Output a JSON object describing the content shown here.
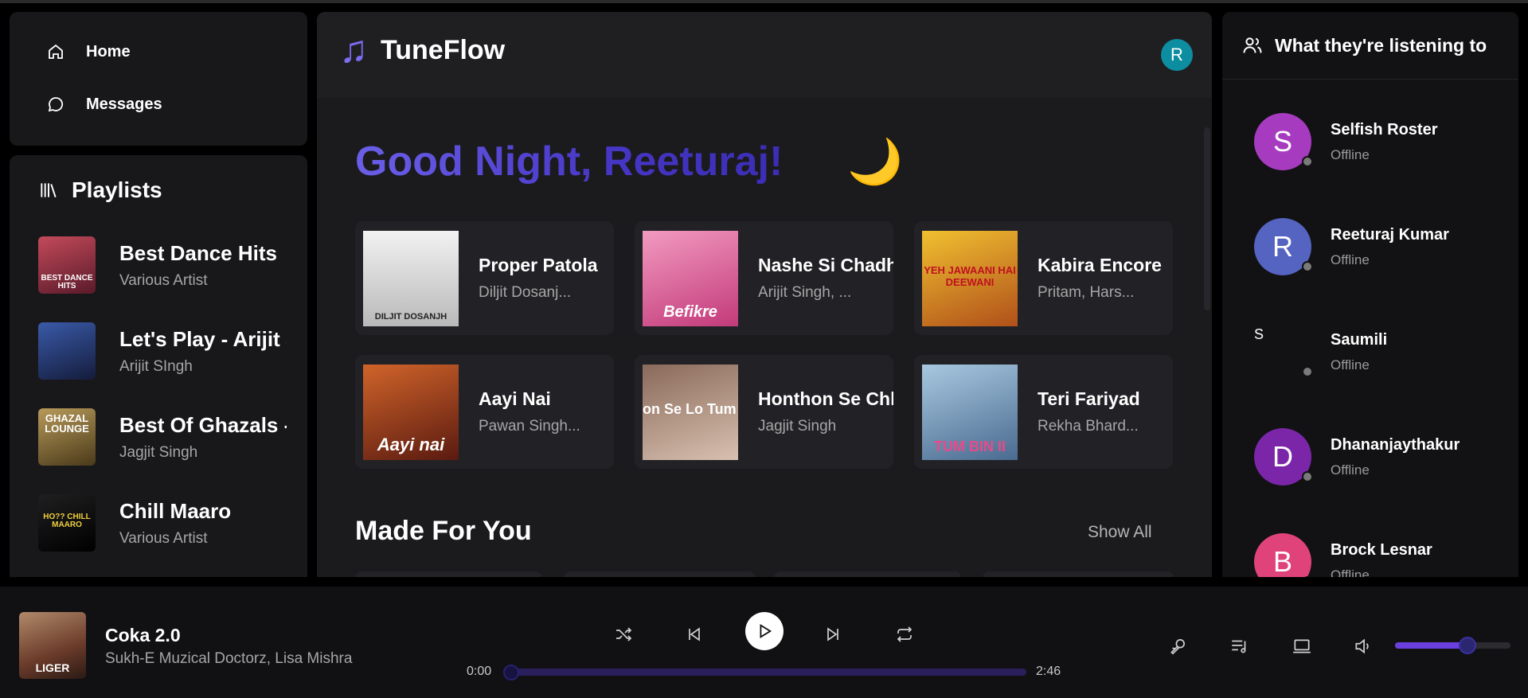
{
  "app": {
    "name": "TuneFlow",
    "user_initial": "R"
  },
  "nav": [
    {
      "label": "Home",
      "icon": "home-icon"
    },
    {
      "label": "Messages",
      "icon": "message-icon"
    }
  ],
  "playlists": {
    "heading": "Playlists",
    "items": [
      {
        "title": "Best Dance Hits",
        "subtitle": "Various Artist",
        "art_text": "BEST DANCE HITS",
        "color": "#8a2e3e"
      },
      {
        "title": "Let's Play - Arijit Singh",
        "subtitle": "Arijit SIngh",
        "art_text": "",
        "color": "#23335e"
      },
      {
        "title": "Best Of Ghazals - Jagjit Singh",
        "subtitle": "Jagjit Singh",
        "art_text": "GHAZAL LOUNGE",
        "color": "#8a6a3a"
      },
      {
        "title": "Chill Maaro",
        "subtitle": "Various Artist",
        "art_text": "HO?? CHILL MAARO",
        "color": "#1a1a1a"
      }
    ]
  },
  "greeting": {
    "text": "Good Night, Reeturaj!",
    "emoji": "🌙"
  },
  "recent": [
    {
      "title": "Proper Patola",
      "artist": "Diljit Dosanj...",
      "art_text": "DILJIT DOSANJH",
      "color": "#d9d9d9"
    },
    {
      "title": "Nashe Si Chadh Gayi",
      "artist": "Arijit Singh, ...",
      "art_text": "Befikre",
      "color": "#d75a8a"
    },
    {
      "title": "Kabira Encore",
      "artist": "Pritam, Hars...",
      "art_text": "YEH JAWAANI HAI DEEWANI",
      "color": "#c8a02a"
    },
    {
      "title": "Aayi Nai",
      "artist": "Pawan Singh...",
      "art_text": "Aayi nai",
      "color": "#a5421f"
    },
    {
      "title": "Honthon Se Chhoo Lo Tum",
      "artist": "Jagjit Singh",
      "art_text": "on Se Lo Tum",
      "color": "#6b4a3a"
    },
    {
      "title": "Teri Fariyad",
      "artist": "Rekha Bhard...",
      "art_text": "TUM BIN II",
      "color": "#6b8fb0"
    }
  ],
  "made_for_you": {
    "title": "Made For You",
    "show_all": "Show All"
  },
  "friends": {
    "heading": "What they're listening to",
    "items": [
      {
        "initial": "S",
        "name": "Selfish Roster",
        "status": "Offline",
        "color": "#a73bc0"
      },
      {
        "initial": "R",
        "name": "Reeturaj Kumar",
        "status": "Offline",
        "color": "#5563c1"
      },
      {
        "initial": "S",
        "name": "Saumili",
        "status": "Offline",
        "color": "transparent"
      },
      {
        "initial": "D",
        "name": "Dhananjaythakur",
        "status": "Offline",
        "color": "#7b26a8"
      },
      {
        "initial": "B",
        "name": "Brock Lesnar",
        "status": "Offline",
        "color": "#e0437a"
      }
    ]
  },
  "player": {
    "title": "Coka 2.0",
    "artist": "Sukh-E Muzical Doctorz, Lisa Mishra",
    "art_text": "LIGER",
    "current_time": "0:00",
    "duration": "2:46",
    "progress": 0.0,
    "volume": 0.63
  }
}
